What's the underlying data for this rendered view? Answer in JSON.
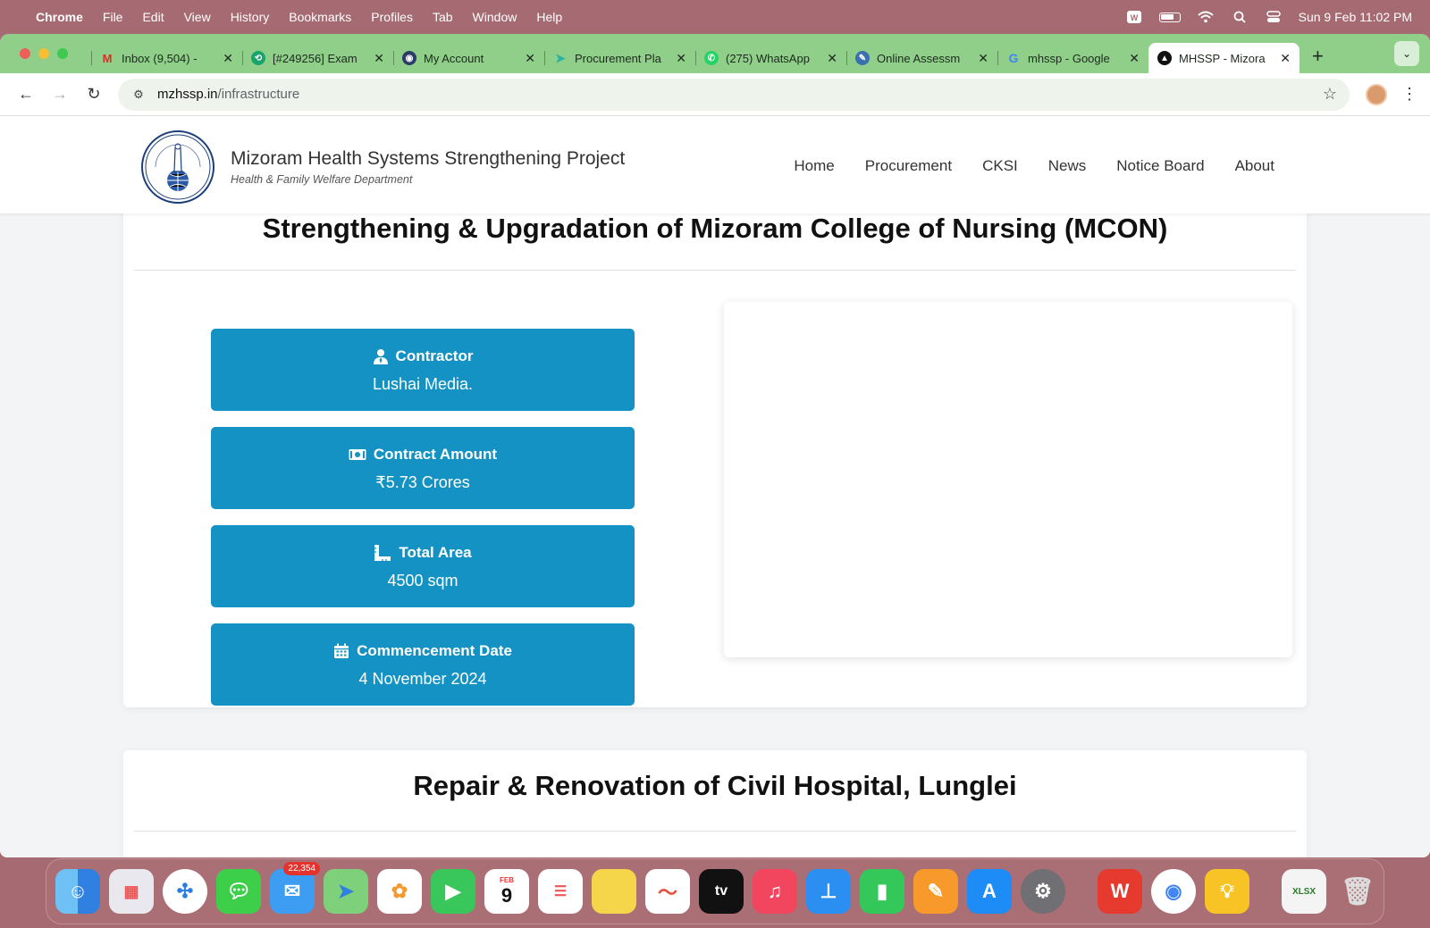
{
  "menubar": {
    "app": "Chrome",
    "items": [
      "File",
      "Edit",
      "View",
      "History",
      "Bookmarks",
      "Profiles",
      "Tab",
      "Window",
      "Help"
    ],
    "datetime": "Sun 9 Feb  11:02 PM"
  },
  "tabs": [
    {
      "title": "Inbox (9,504) - ",
      "icon": "gmail-icon",
      "color": "#ffffff"
    },
    {
      "title": "[#249256] Exam",
      "icon": "ticket-icon",
      "color": "#1aa36a"
    },
    {
      "title": "My Account",
      "icon": "account-icon",
      "color": "#2b3a67"
    },
    {
      "title": "Procurement Pla",
      "icon": "procurement-icon",
      "color": "#2bb3a3"
    },
    {
      "title": "(275) WhatsApp",
      "icon": "whatsapp-icon",
      "color": "#25d366"
    },
    {
      "title": "Online Assessm",
      "icon": "assessment-icon",
      "color": "#3a6fb0"
    },
    {
      "title": "mhssp - Google",
      "icon": "google-icon",
      "color": "#ffffff"
    },
    {
      "title": "MHSSP - Mizora",
      "icon": "mhssp-icon",
      "color": "#111111",
      "active": true
    }
  ],
  "address": {
    "host": "mzhssp.in",
    "path": "/infrastructure"
  },
  "site": {
    "title": "Mizoram Health Systems Strengthening Project",
    "subtitle": "Health & Family Welfare Department",
    "logo_text": "MIZORAM HEALTH SYSTEMS STRENGTHENING PROJECT",
    "nav": [
      "Home",
      "Procurement",
      "CKSI",
      "News",
      "Notice Board",
      "About"
    ]
  },
  "projects": [
    {
      "title": "Strengthening & Upgradation of Mizoram College of Nursing (MCON)",
      "details": [
        {
          "label": "Contractor",
          "value": "Lushai Media.",
          "icon": "user-tie-icon"
        },
        {
          "label": "Contract Amount",
          "value": "₹5.73 Crores",
          "icon": "money-bill-icon"
        },
        {
          "label": "Total Area",
          "value": "4500 sqm",
          "icon": "ruler-combined-icon"
        },
        {
          "label": "Commencement Date",
          "value": "4 November 2024",
          "icon": "calendar-icon"
        }
      ]
    },
    {
      "title": "Repair & Renovation of Civil Hospital, Lunglei"
    }
  ],
  "dock": {
    "mail_badge": "22,354",
    "calendar_month": "FEB",
    "calendar_day": "9",
    "apps": [
      "Finder",
      "Launchpad",
      "Safari",
      "Messages",
      "Mail",
      "Maps",
      "Photos",
      "FaceTime",
      "Calendar",
      "Reminders",
      "Notes",
      "Freeform",
      "TV",
      "Music",
      "Keynote",
      "Numbers",
      "Pages",
      "App Store",
      "System Settings",
      "WPS Office",
      "Google Chrome",
      "Tips",
      "XLSX file",
      "Trash"
    ]
  },
  "colors": {
    "accent": "#1592c4",
    "tabstrip": "#8fcf8a",
    "desktop": "#a56a72"
  }
}
